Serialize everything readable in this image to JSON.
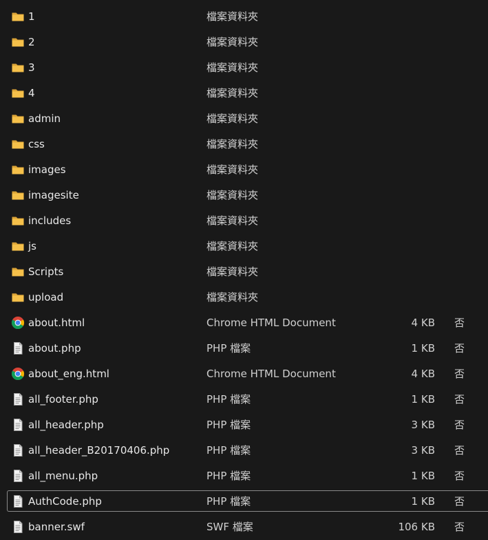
{
  "files": [
    {
      "name": "1",
      "type": "檔案資料夾",
      "size": "",
      "available": "",
      "icon": "folder-icon"
    },
    {
      "name": "2",
      "type": "檔案資料夾",
      "size": "",
      "available": "",
      "icon": "folder-icon"
    },
    {
      "name": "3",
      "type": "檔案資料夾",
      "size": "",
      "available": "",
      "icon": "folder-icon"
    },
    {
      "name": "4",
      "type": "檔案資料夾",
      "size": "",
      "available": "",
      "icon": "folder-icon"
    },
    {
      "name": "admin",
      "type": "檔案資料夾",
      "size": "",
      "available": "",
      "icon": "folder-icon"
    },
    {
      "name": "css",
      "type": "檔案資料夾",
      "size": "",
      "available": "",
      "icon": "folder-icon"
    },
    {
      "name": "images",
      "type": "檔案資料夾",
      "size": "",
      "available": "",
      "icon": "folder-icon"
    },
    {
      "name": "imagesite",
      "type": "檔案資料夾",
      "size": "",
      "available": "",
      "icon": "folder-icon"
    },
    {
      "name": "includes",
      "type": "檔案資料夾",
      "size": "",
      "available": "",
      "icon": "folder-icon"
    },
    {
      "name": "js",
      "type": "檔案資料夾",
      "size": "",
      "available": "",
      "icon": "folder-icon"
    },
    {
      "name": "Scripts",
      "type": "檔案資料夾",
      "size": "",
      "available": "",
      "icon": "folder-icon"
    },
    {
      "name": "upload",
      "type": "檔案資料夾",
      "size": "",
      "available": "",
      "icon": "folder-icon"
    },
    {
      "name": "about.html",
      "type": "Chrome HTML Document",
      "size": "4 KB",
      "available": "否",
      "icon": "chrome-icon"
    },
    {
      "name": "about.php",
      "type": "PHP 檔案",
      "size": "1 KB",
      "available": "否",
      "icon": "file-icon"
    },
    {
      "name": "about_eng.html",
      "type": "Chrome HTML Document",
      "size": "4 KB",
      "available": "否",
      "icon": "chrome-icon"
    },
    {
      "name": "all_footer.php",
      "type": "PHP 檔案",
      "size": "1 KB",
      "available": "否",
      "icon": "file-icon"
    },
    {
      "name": "all_header.php",
      "type": "PHP 檔案",
      "size": "3 KB",
      "available": "否",
      "icon": "file-icon"
    },
    {
      "name": "all_header_B20170406.php",
      "type": "PHP 檔案",
      "size": "3 KB",
      "available": "否",
      "icon": "file-icon"
    },
    {
      "name": "all_menu.php",
      "type": "PHP 檔案",
      "size": "1 KB",
      "available": "否",
      "icon": "file-icon"
    },
    {
      "name": "AuthCode.php",
      "type": "PHP 檔案",
      "size": "1 KB",
      "available": "否",
      "icon": "file-icon",
      "focused": true
    },
    {
      "name": "banner.swf",
      "type": "SWF 檔案",
      "size": "106 KB",
      "available": "否",
      "icon": "file-icon"
    }
  ],
  "colors": {
    "background": "#191919",
    "folder": "#f5c04a",
    "focus_border": "#8a8a8a"
  }
}
